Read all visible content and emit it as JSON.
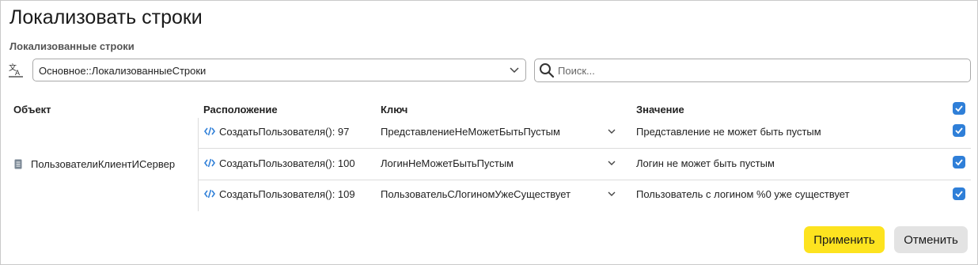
{
  "dialog": {
    "title": "Локализовать строки",
    "section_label": "Локализованные строки",
    "source_select": {
      "value": "Основное::ЛокализованныеСтроки"
    },
    "search": {
      "placeholder": "Поиск..."
    }
  },
  "table": {
    "columns": {
      "object": "Объект",
      "location": "Расположение",
      "key": "Ключ",
      "value": "Значение"
    },
    "header_checked": true,
    "object": "ПользователиКлиентИСервер",
    "rows": [
      {
        "location": "СоздатьПользователя(): 97",
        "key": "ПредставлениеНеМожетБытьПустым",
        "value": "Представление не может быть пустым",
        "checked": true
      },
      {
        "location": "СоздатьПользователя(): 100",
        "key": "ЛогинНеМожетБытьПустым",
        "value": "Логин не может быть пустым",
        "checked": true
      },
      {
        "location": "СоздатьПользователя(): 109",
        "key": "ПользовательСЛогиномУжеСуществует",
        "value": "Пользователь с логином %0 уже существует",
        "checked": true
      }
    ]
  },
  "buttons": {
    "apply": "Применить",
    "cancel": "Отменить"
  },
  "colors": {
    "accent_blue": "#2f7fd8",
    "apply_yellow": "#fde31f",
    "cancel_gray": "#e3e3e3"
  }
}
